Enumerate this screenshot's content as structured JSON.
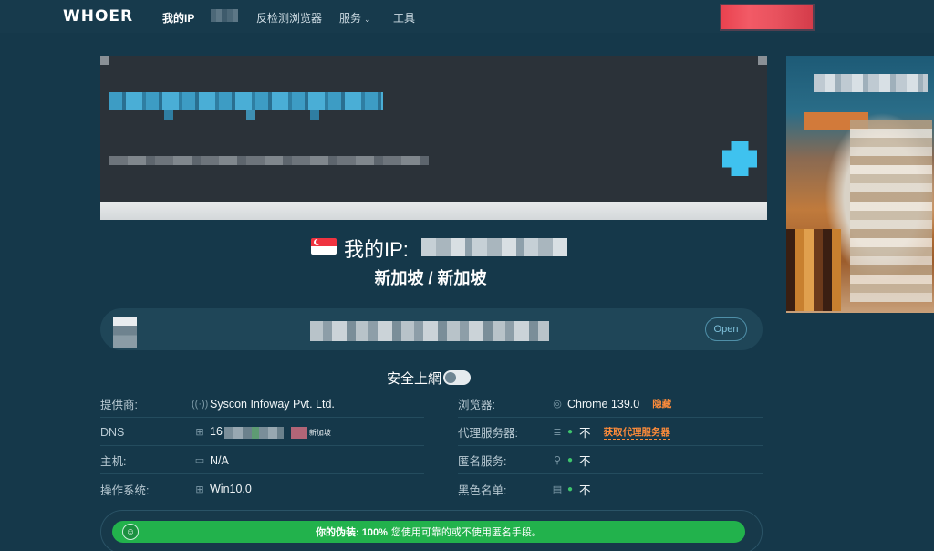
{
  "nav": {
    "logo": "WHOER",
    "items": [
      {
        "label": "我的IP",
        "active": true
      },
      {
        "label": "反检测浏览器"
      },
      {
        "label": "服务",
        "chevron": "⌄"
      },
      {
        "label": "工具"
      }
    ]
  },
  "ip_header": {
    "label": "我的IP:",
    "location": "新加坡 / 新加坡",
    "flag": "singapore-flag"
  },
  "address_bar": {
    "open_label": "Open"
  },
  "safe_browsing": {
    "label": "安全上網",
    "enabled": false
  },
  "info": {
    "left": [
      {
        "key": "提供商:",
        "icon": "broadcast-icon",
        "value": "Syscon Infoway Pvt. Ltd."
      },
      {
        "key": "DNS",
        "icon": "network-icon",
        "value": "16",
        "country": "新加坡"
      },
      {
        "key": "主机:",
        "icon": "monitor-icon",
        "value": "N/A"
      },
      {
        "key": "操作系统:",
        "icon": "windows-icon",
        "value": "Win10.0"
      }
    ],
    "right": [
      {
        "key": "浏览器:",
        "icon": "chrome-icon",
        "value": "Chrome 139.0",
        "link": "隐藏"
      },
      {
        "key": "代理服务器:",
        "icon": "database-icon",
        "value": "不",
        "link": "获取代理服务器"
      },
      {
        "key": "匿名服务:",
        "icon": "user-icon",
        "value": "不"
      },
      {
        "key": "黑色名单:",
        "icon": "list-icon",
        "value": "不"
      }
    ]
  },
  "status": {
    "strong": "你的伪装: 100%",
    "text": "您使用可靠的或不使用匿名手段。",
    "color": "#22b24c"
  },
  "colors": {
    "background": "#15384a",
    "accent_link": "#ff8c3a",
    "success": "#22b24c"
  }
}
